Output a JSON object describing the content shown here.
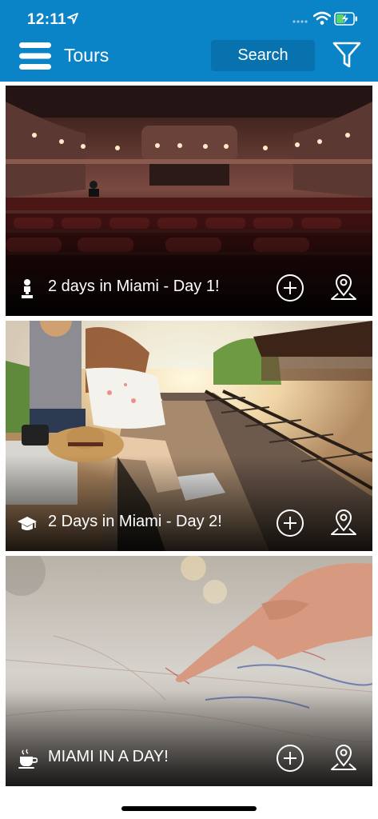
{
  "status_bar": {
    "time": "12:11"
  },
  "header": {
    "title": "Tours",
    "search_label": "Search"
  },
  "tours": [
    {
      "title": "2 days in Miami - Day 1!",
      "category_icon": "person-statue-icon"
    },
    {
      "title": "2 Days in Miami - Day 2!",
      "category_icon": "graduation-cap-icon"
    },
    {
      "title": "MIAMI IN A DAY!",
      "category_icon": "coffee-cup-icon"
    }
  ],
  "colors": {
    "header_bg": "#0a84c6",
    "search_bg": "#0772ad"
  }
}
